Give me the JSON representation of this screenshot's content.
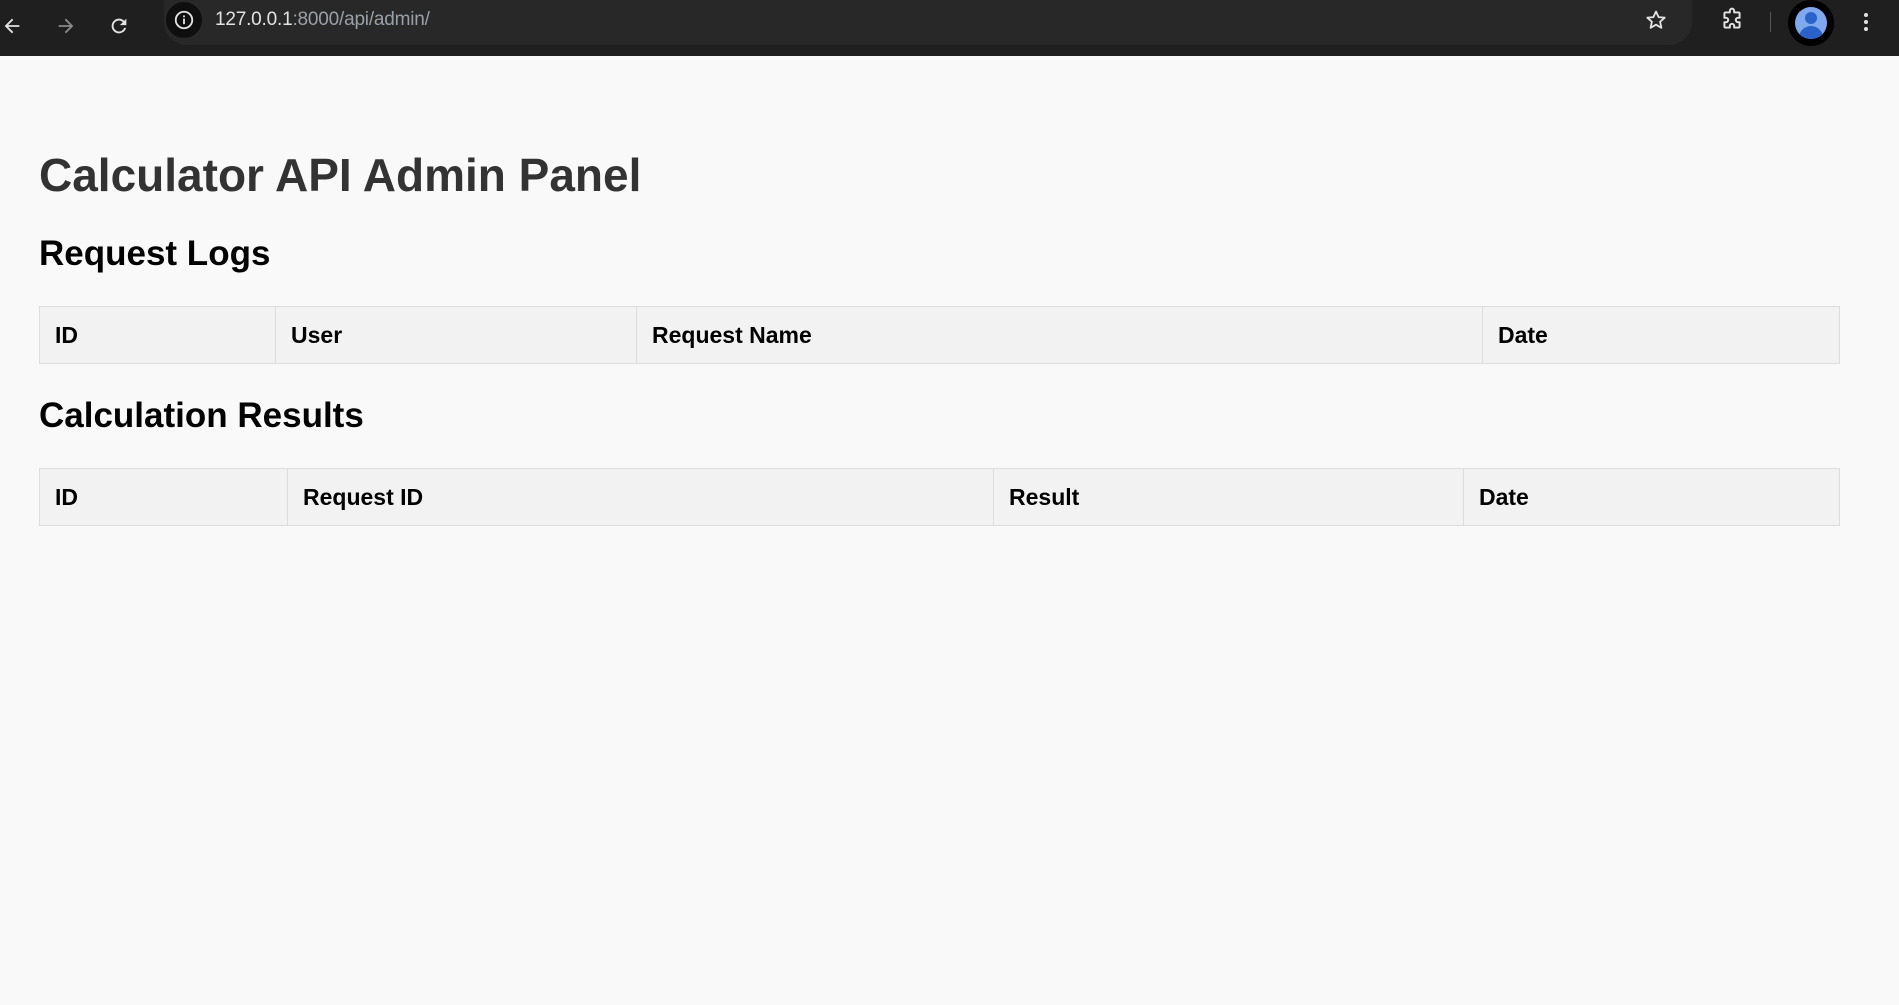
{
  "browser": {
    "url_host": "127.0.0.1",
    "url_rest": ":8000/api/admin/",
    "icons": {
      "back": "arrow-left-icon",
      "forward": "arrow-right-icon",
      "reload": "reload-icon",
      "site_info": "info-icon",
      "bookmark": "star-icon",
      "extensions": "puzzle-icon",
      "profile": "avatar-icon",
      "menu": "more-vert-icon"
    }
  },
  "page": {
    "title": "Calculator API Admin Panel",
    "request_logs": {
      "heading": "Request Logs",
      "columns": [
        "ID",
        "User",
        "Request Name",
        "Date"
      ],
      "rows": []
    },
    "calculation_results": {
      "heading": "Calculation Results",
      "columns": [
        "ID",
        "Request ID",
        "Result",
        "Date"
      ],
      "rows": []
    }
  },
  "colors": {
    "toolbar_bg": "#1f1f1f",
    "omnibox_bg": "#282828",
    "page_bg": "#f9f9f9",
    "table_header_bg": "#f2f2f2",
    "table_border": "#dddddd",
    "title_text": "#333333"
  }
}
